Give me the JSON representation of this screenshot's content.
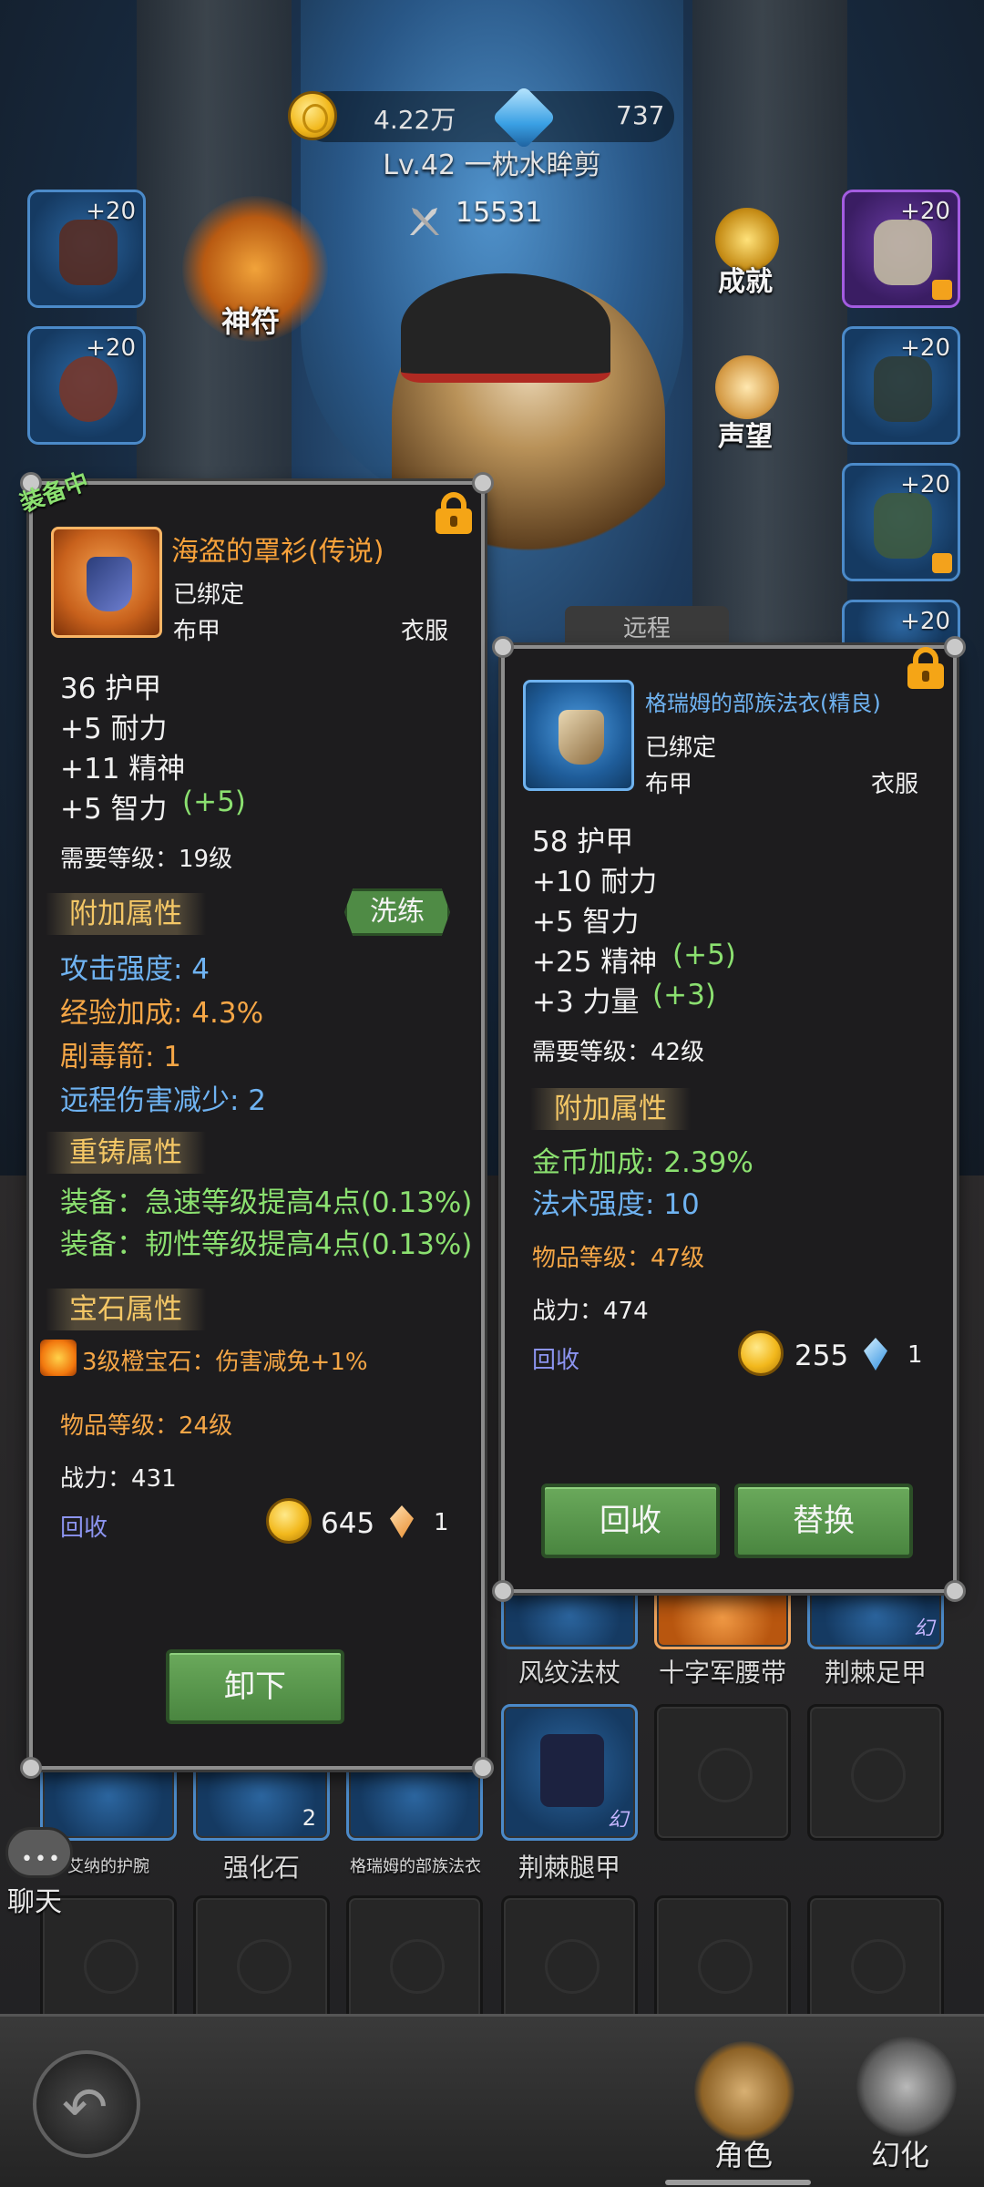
{
  "header": {
    "gold": "4.22万",
    "diamonds": "737",
    "player_name": "Lv.42 一枕水眸剪",
    "power": "15531"
  },
  "side_slots": {
    "left": [
      {
        "plus": "+20"
      },
      {
        "plus": "+20"
      }
    ],
    "right": [
      {
        "plus": "+20"
      },
      {
        "plus": "+20"
      },
      {
        "plus": "+20"
      },
      {
        "plus": "+20"
      }
    ]
  },
  "menu": {
    "rune": "神符",
    "achievement": "成就",
    "reputation": "声望"
  },
  "tab_ranged": "远程",
  "left_panel": {
    "equipped_tag": "装备中",
    "item_name": "海盗的罩衫(传说)",
    "bound": "已绑定",
    "material": "布甲",
    "slot": "衣服",
    "stats": [
      "36 护甲",
      "+5 耐力",
      "+11 精神",
      "+5 智力"
    ],
    "stat_bonus": "(+5)",
    "required_level": "需要等级：19级",
    "extra_attr_title": "附加属性",
    "reroll_button": "洗练",
    "extra_attrs": [
      "攻击强度: 4",
      "经验加成: 4.3%",
      "剧毒箭: 1",
      "远程伤害减少: 2"
    ],
    "reforge_title": "重铸属性",
    "reforge_attrs": [
      "装备：急速等级提高4点(0.13%)",
      "装备：韧性等级提高4点(0.13%)"
    ],
    "gem_title": "宝石属性",
    "gem_attr": "3级橙宝石：伤害减免+1%",
    "item_level": "物品等级：24级",
    "power": "战力：431",
    "recycle_label": "回收",
    "recycle_gold": "645",
    "recycle_shard": "1",
    "unequip_button": "卸下"
  },
  "right_panel": {
    "item_name": "格瑞姆的部族法衣(精良)",
    "bound": "已绑定",
    "material": "布甲",
    "slot": "衣服",
    "stats": [
      "58 护甲",
      "+10 耐力",
      "+5 智力",
      "+25 精神",
      "+3 力量"
    ],
    "stat_bonus_1": "(+5)",
    "stat_bonus_2": "(+3)",
    "required_level": "需要等级：42级",
    "extra_attr_title": "附加属性",
    "extra_attrs": [
      "金币加成: 2.39%",
      "法术强度: 10"
    ],
    "item_level": "物品等级：47级",
    "power": "战力：474",
    "recycle_label": "回收",
    "recycle_gold": "255",
    "recycle_shard": "1",
    "recycle_button": "回收",
    "replace_button": "替换"
  },
  "bag": {
    "row1_labels": [
      "风纹法杖",
      "十字军腰带",
      "荆棘足甲"
    ],
    "row2_labels": [
      "艾纳的护腕",
      "强化石",
      "格瑞姆的部族法衣",
      "荆棘腿甲"
    ],
    "stone_count": "2",
    "huan_mark": "幻"
  },
  "chat": {
    "dots": "•••",
    "label": "聊天"
  },
  "bottom_nav": {
    "role": "角色",
    "illusion": "幻化"
  }
}
